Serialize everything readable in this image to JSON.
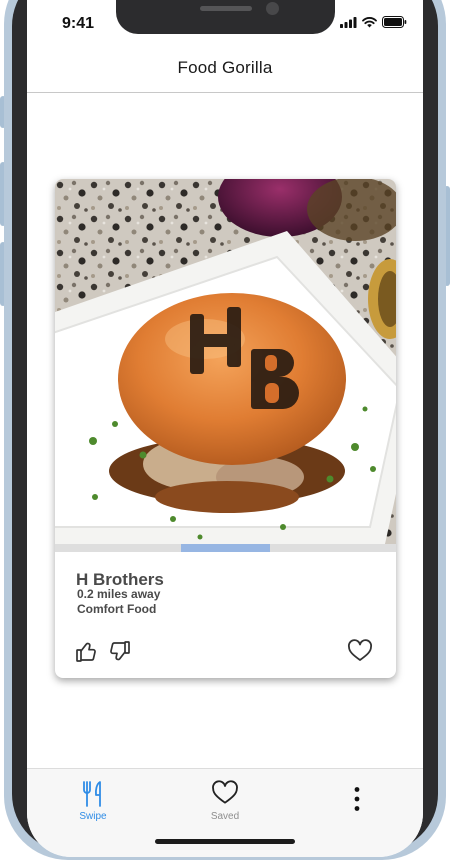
{
  "status_bar": {
    "time": "9:41"
  },
  "header": {
    "title": "Food Gorilla"
  },
  "card": {
    "name": "H Brothers",
    "distance": "0.2 miles away",
    "category": "Comfort Food",
    "photo_icon": "burger-photo",
    "progress": {
      "start": 0.37,
      "end": 0.63
    }
  },
  "actions": {
    "like_icon": "thumbs-up-icon",
    "dislike_icon": "thumbs-down-icon",
    "save_icon": "heart-icon"
  },
  "tabs": [
    {
      "label": "Swipe",
      "icon": "fork-knife-icon",
      "active": true
    },
    {
      "label": "Saved",
      "icon": "heart-icon",
      "active": false
    },
    {
      "label": "",
      "icon": "more-vertical-icon",
      "active": false
    }
  ],
  "colors": {
    "accent": "#2f8ce6",
    "inactive": "#8e8e8e",
    "progress_fill": "#97b6e3",
    "progress_track": "#dedede"
  }
}
